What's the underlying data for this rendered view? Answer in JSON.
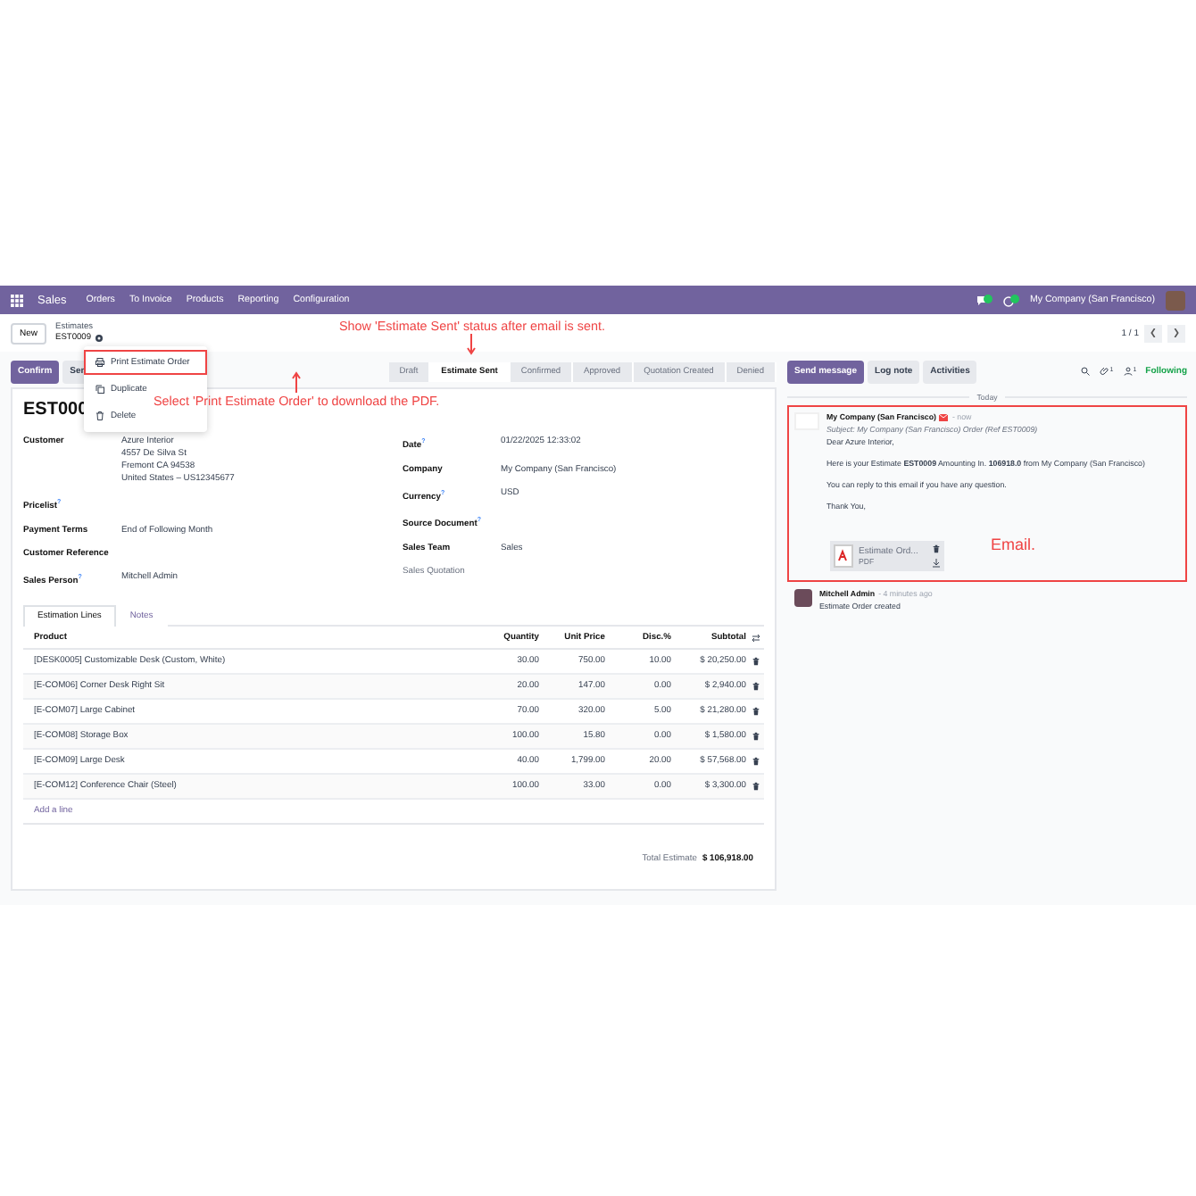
{
  "navbar": {
    "app": "Sales",
    "menu": [
      "Orders",
      "To Invoice",
      "Products",
      "Reporting",
      "Configuration"
    ],
    "company": "My Company (San Francisco)"
  },
  "breadcrumb": {
    "new": "New",
    "parent": "Estimates",
    "current": "EST0009"
  },
  "pager": "1 / 1",
  "actions": [
    {
      "label": "Confirm",
      "primary": true
    },
    {
      "label": "Sen",
      "primary": false
    }
  ],
  "dropdown": [
    {
      "kind": "print",
      "label": "Print Estimate Order",
      "highlighted": true
    },
    {
      "kind": "copy",
      "label": "Duplicate",
      "highlighted": false
    },
    {
      "kind": "trash",
      "label": "Delete",
      "highlighted": false
    }
  ],
  "statusbar": [
    {
      "label": "Draft",
      "selected": false
    },
    {
      "label": "Estimate Sent",
      "selected": true
    },
    {
      "label": "Confirmed",
      "selected": false
    },
    {
      "label": "Approved",
      "selected": false
    },
    {
      "label": "Quotation Created",
      "selected": false
    },
    {
      "label": "Denied",
      "selected": false
    }
  ],
  "form": {
    "title": "EST000",
    "left": [
      {
        "label": "Customer",
        "lines": [
          "Azure Interior",
          "4557 De Silva St",
          "Fremont CA 94538",
          "United States – US12345677"
        ]
      },
      {
        "label": "Pricelist",
        "help": "?"
      },
      {
        "label": "Payment Terms",
        "lines": [
          "End of Following Month"
        ]
      },
      {
        "label": "Customer Reference"
      },
      {
        "label": "Sales Person",
        "help": "?",
        "lines": [
          "Mitchell Admin"
        ]
      }
    ],
    "right": [
      {
        "label": "Date",
        "help": "?",
        "lines": [
          "01/22/2025 12:33:02"
        ]
      },
      {
        "label": "Company",
        "lines": [
          "My Company (San Francisco)"
        ]
      },
      {
        "label": "Currency",
        "help": "?",
        "lines": [
          "USD"
        ]
      },
      {
        "label": "Source Document",
        "help": "?"
      },
      {
        "label": "Sales Team",
        "lines": [
          "Sales"
        ]
      },
      {
        "label": "Sales Quotation",
        "muted": true
      }
    ]
  },
  "tabs": [
    {
      "label": "Estimation Lines",
      "selected": true
    },
    {
      "label": "Notes",
      "selected": false
    }
  ],
  "table": {
    "columns": [
      "Product",
      "Quantity",
      "Unit Price",
      "Disc.%",
      "Subtotal"
    ],
    "rows": [
      [
        "[DESK0005] Customizable Desk (Custom, White)",
        "30.00",
        "750.00",
        "10.00",
        "$ 20,250.00"
      ],
      [
        "[E-COM06] Corner Desk Right Sit",
        "20.00",
        "147.00",
        "0.00",
        "$ 2,940.00"
      ],
      [
        "[E-COM07] Large Cabinet",
        "70.00",
        "320.00",
        "5.00",
        "$ 21,280.00"
      ],
      [
        "[E-COM08] Storage Box",
        "100.00",
        "15.80",
        "0.00",
        "$ 1,580.00"
      ],
      [
        "[E-COM09] Large Desk",
        "40.00",
        "1,799.00",
        "20.00",
        "$ 57,568.00"
      ],
      [
        "[E-COM12] Conference Chair (Steel)",
        "100.00",
        "33.00",
        "0.00",
        "$ 3,300.00"
      ]
    ],
    "add_line": "Add a line",
    "total_label": "Total Estimate",
    "total": "$ 106,918.00"
  },
  "chatter": {
    "buttons": [
      {
        "label": "Send message",
        "selected": true
      },
      {
        "label": "Log note",
        "selected": false
      },
      {
        "label": "Activities",
        "selected": false
      }
    ],
    "attachments": "1",
    "followers": "1",
    "follow": "Following",
    "divider": "Today",
    "messages": [
      {
        "kind": "email",
        "author": "My Company (San Francisco)",
        "time": "- now",
        "subject": "Subject: My Company (San Francisco) Order (Ref EST0009)",
        "highlighted": true,
        "paragraphs": [
          "Dear Azure Interior,",
          "Here is your Estimate **EST0009** Amounting In. **106918.0** from My Company (San Francisco)",
          "You can reply to this email if you have any question.",
          "Thank You,"
        ],
        "attachment": {
          "name": "Estimate Ord...",
          "type": "PDF"
        }
      },
      {
        "kind": "note",
        "author": "Mitchell Admin",
        "time": "- 4 minutes ago",
        "highlighted": false,
        "paragraphs": [
          "Estimate Order created"
        ]
      }
    ]
  },
  "annotations": [
    {
      "text": "Show 'Estimate Sent' status after email is sent.",
      "kind": "down"
    },
    {
      "text": "Select 'Print Estimate Order' to download the PDF.",
      "kind": "up"
    },
    {
      "text": "Email.",
      "kind": "plain"
    }
  ]
}
